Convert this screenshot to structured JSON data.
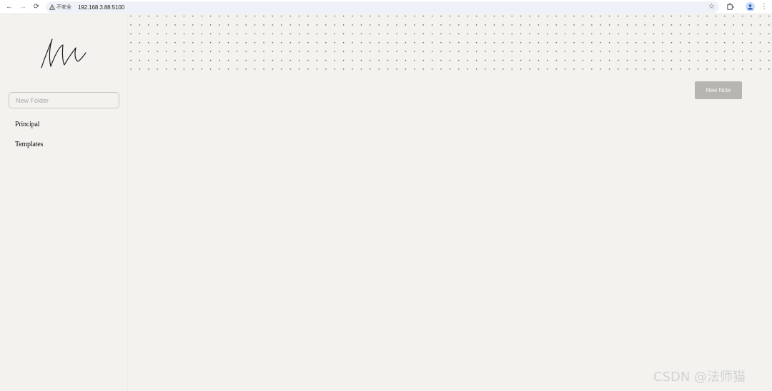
{
  "browser": {
    "security_label": "不安全",
    "url": "192.168.3.88:5100"
  },
  "sidebar": {
    "new_folder_placeholder": "New Folder",
    "folders": [
      {
        "label": "Principal"
      },
      {
        "label": "Templates"
      }
    ]
  },
  "main": {
    "new_note_label": "New Note"
  },
  "watermark": "CSDN @法师猫"
}
